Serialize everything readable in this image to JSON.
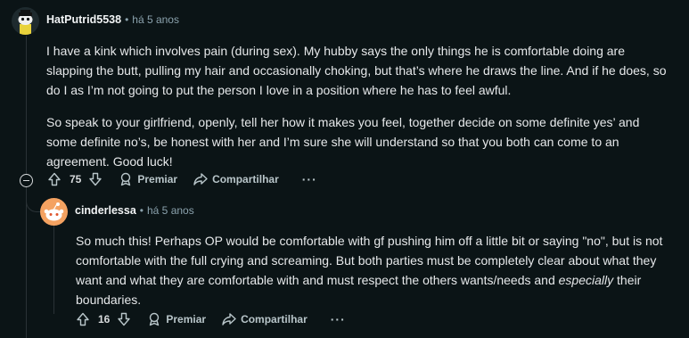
{
  "comments": [
    {
      "author": "HatPutrid5538",
      "separator": "•",
      "timestamp": "há 5 anos",
      "paragraphs": [
        "I have a kink which involves pain (during sex). My hubby says the only things he is comfortable doing are slapping the butt, pulling my hair and occasionally choking, but that’s where he draws the line. And if he does, so do I as I’m not going to put the person I love in a position where he has to feel awful.",
        "So speak to your girlfriend, openly, tell her how it makes you feel, together decide on some definite yes’ and some definite no’s, be honest with her and I’m sure she will understand so that you both can come to an agreement. Good luck!"
      ],
      "votes": "75",
      "award_label": "Premiar",
      "share_label": "Compartilhar",
      "more_label": "···"
    },
    {
      "author": "cinderlessa",
      "separator": "•",
      "timestamp": "há 5 anos",
      "paragraph_start": "So much this! Perhaps OP would be comfortable with gf pushing him off a little bit or saying \"no\", but is not comfortable with the full crying and screaming. But both parties must be completely clear about what they want and what they are comfortable with and must respect the others wants/needs and ",
      "paragraph_emphasis": "especially",
      "paragraph_end": " their boundaries.",
      "votes": "16",
      "award_label": "Premiar",
      "share_label": "Compartilhar",
      "more_label": "···"
    }
  ],
  "colors": {
    "background": "#0b1416",
    "upvote_icon": "upvote-arrow-icon",
    "downvote_icon": "downvote-arrow-icon"
  }
}
